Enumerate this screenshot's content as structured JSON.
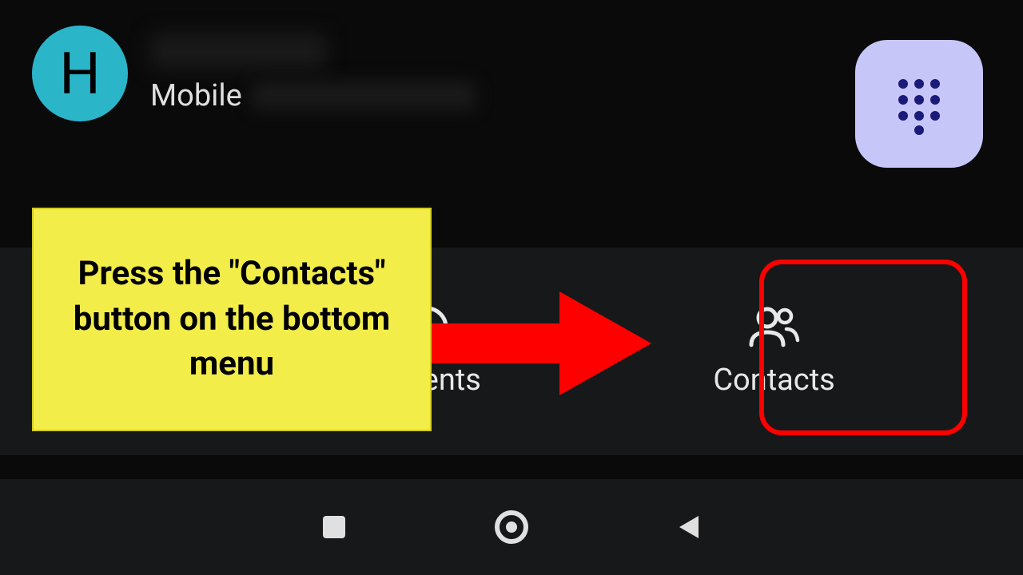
{
  "contact": {
    "avatar_letter": "H",
    "type_label": "Mobile"
  },
  "callout": {
    "text": "Press the \"Contacts\" button on the bottom menu"
  },
  "nav": {
    "recents_label": "Recents",
    "contacts_label": "Contacts"
  }
}
